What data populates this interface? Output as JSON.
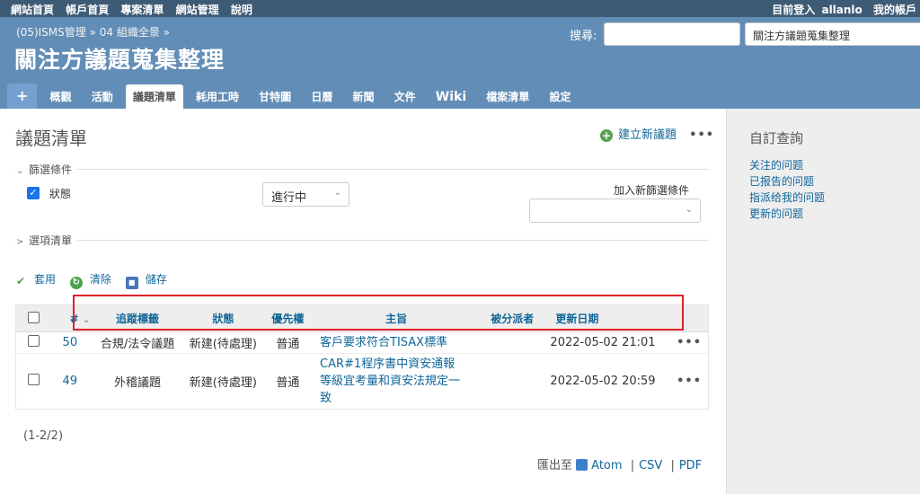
{
  "top_menu": {
    "left": [
      "網站首頁",
      "帳戶首頁",
      "專案清單",
      "網站管理",
      "說明"
    ],
    "logged_in_label": "目前登入",
    "user": "allanlo",
    "my_account": "我的帳戶"
  },
  "header": {
    "breadcrumb": "(05)ISMS管理 » 04 組織全景 »",
    "title": "關注方議題蒐集整理",
    "search_label": "搜尋:",
    "project_jump": "關注方議題蒐集整理"
  },
  "main_menu": {
    "plus": "+",
    "tabs": [
      "概觀",
      "活動",
      "議題清單",
      "耗用工時",
      "甘特圖",
      "日曆",
      "新聞",
      "文件",
      "Wiki",
      "檔案清單",
      "設定"
    ]
  },
  "content": {
    "title": "議題清單",
    "new_issue": "建立新議題",
    "more": "•••",
    "filters_legend": "篩選條件",
    "status_label": "狀態",
    "status_value": "進行中",
    "add_filter_label": "加入新篩選條件",
    "options_legend": "選項清單",
    "apply": "套用",
    "clear": "清除",
    "save": "儲存"
  },
  "table": {
    "headers": [
      "#",
      "追蹤標籤",
      "狀態",
      "優先權",
      "主旨",
      "被分派者",
      "更新日期"
    ],
    "rows": [
      {
        "id": "50",
        "tracker": "合規/法令議題",
        "status": "新建(待處理)",
        "priority": "普通",
        "subject": "客戶要求符合TISAX標準",
        "assignee": "",
        "updated": "2022-05-02 21:01"
      },
      {
        "id": "49",
        "tracker": "外稽議題",
        "status": "新建(待處理)",
        "priority": "普通",
        "subject": "CAR#1程序書中資安通報等級宜考量和資安法規定一致",
        "assignee": "",
        "updated": "2022-05-02 20:59"
      }
    ]
  },
  "pagination": "(1-2/2)",
  "export": {
    "label": "匯出至",
    "atom": "Atom",
    "csv": "CSV",
    "pdf": "PDF"
  },
  "sidebar": {
    "title": "自訂查詢",
    "links": [
      "关注的问题",
      "已报告的问题",
      "指派给我的问题",
      "更新的问题"
    ]
  }
}
